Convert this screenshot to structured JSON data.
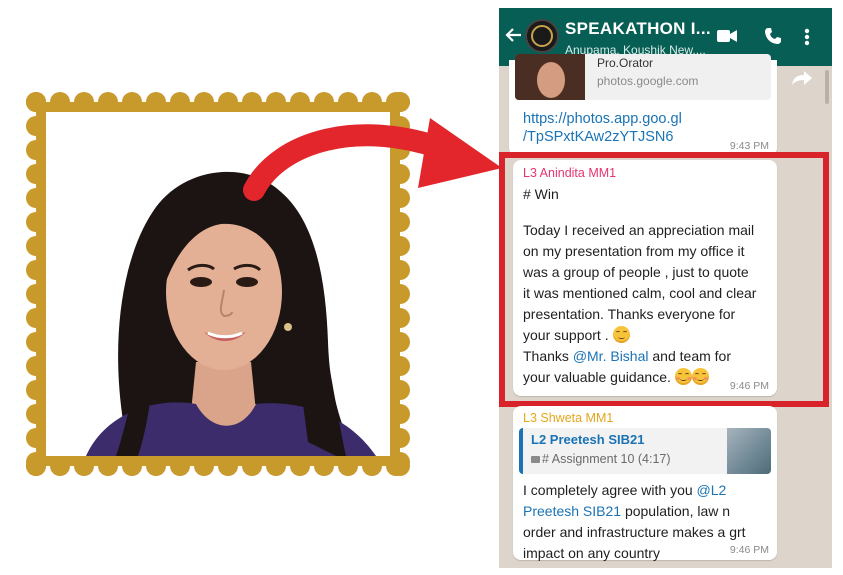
{
  "chat": {
    "title": "SPEAKATHON I...",
    "members": "Anupama, Koushik New,..."
  },
  "link_preview": {
    "title": "Pro.Orator",
    "domain": "photos.google.com",
    "link_line1": "https://photos.app.goo.gl",
    "link_line2": "/TpSPxtKAw2zYTJSN6",
    "time": "9:43 PM"
  },
  "highlighted_message": {
    "sender": "L3 Anindita MM1",
    "sender_color": "#e6356f",
    "line1": "# Win",
    "line2": "Today I received an appreciation mail",
    "line3": "on my presentation from my office it",
    "line4": "was a group of people , just to quote",
    "line5": "it was mentioned calm, cool and clear",
    "line6": "presentation. Thanks everyone for",
    "line7": "your support .",
    "line8_pre": "Thanks ",
    "line8_mention": "@Mr. Bishal",
    "line8_post": " and team for",
    "line9": "your valuable guidance. ",
    "time": "9:46 PM"
  },
  "reply_message": {
    "sender": "L3 Shweta MM1",
    "sender_color": "#e5a61a",
    "quoted_sender": "L2 Preetesh SIB21",
    "quoted_text": "# Assignment 10 (4:17)",
    "line1_pre": "I completely agree with you ",
    "line1_mention": "@L2",
    "line2_mention": "Preetesh SIB21",
    "line2_post": " population, law n",
    "line3": "order and infrastructure makes a grt",
    "line4": "impact on any country",
    "time": "9:46 PM"
  },
  "colors": {
    "frame": "#c89a2c",
    "arrow": "#e3262b",
    "header": "#075e54",
    "highlight_border": "#d8232a",
    "link": "#1a73b5"
  },
  "icons": [
    "back-arrow-icon",
    "video-call-icon",
    "phone-call-icon",
    "more-vert-icon",
    "forward-icon",
    "video-icon"
  ]
}
